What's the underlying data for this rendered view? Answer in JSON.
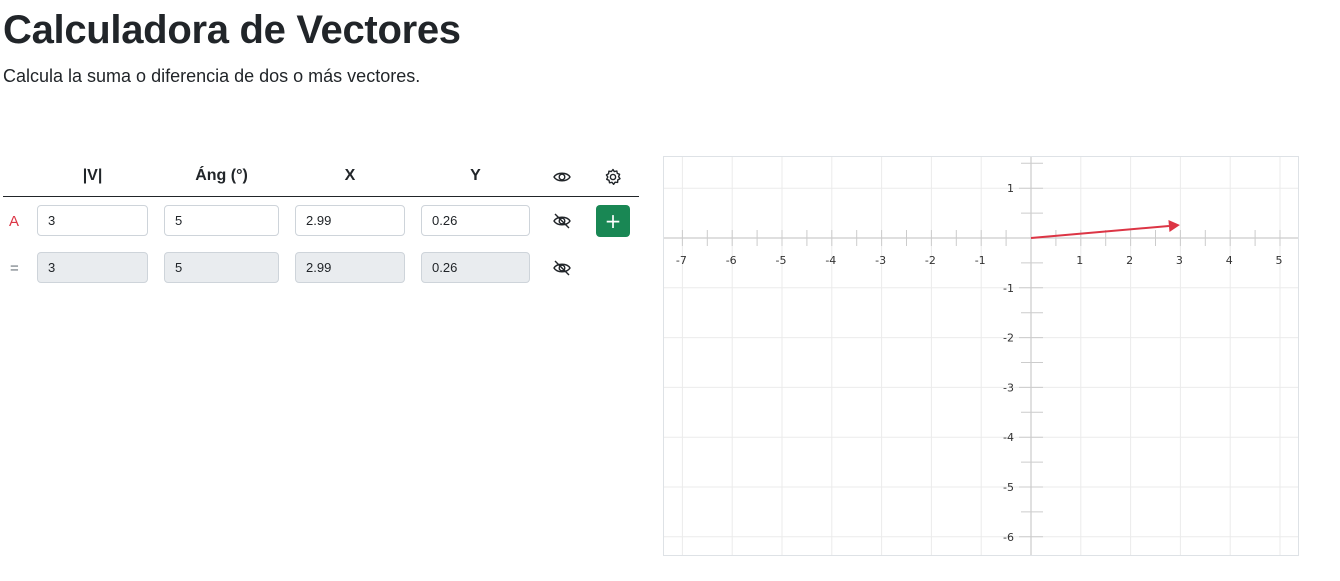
{
  "page": {
    "title": "Calculadora de Vectores",
    "subtitle": "Calcula la suma o diferencia de dos o más vectores."
  },
  "table": {
    "headers": {
      "magnitude": "|V|",
      "angle": "Áng (°)",
      "x": "X",
      "y": "Y"
    },
    "header_icons": {
      "visibility": "eye-icon",
      "settings": "gear-icon"
    },
    "rows": [
      {
        "label": "A",
        "magnitude": "3",
        "angle": "5",
        "x": "2.99",
        "y": "0.26",
        "visibility_icon": "eye-off-icon",
        "action": "+"
      },
      {
        "label": "=",
        "magnitude": "3",
        "angle": "5",
        "x": "2.99",
        "y": "0.26",
        "visibility_icon": "eye-off-icon",
        "readonly": true
      }
    ]
  },
  "colors": {
    "vector_a": "#dc3545",
    "add_button": "#198754",
    "readonly_field": "#e9ecef",
    "grid": "#ebebeb",
    "axis": "#cccccc"
  },
  "graph": {
    "x_ticks": [
      -7,
      -6,
      -5,
      -4,
      -3,
      -2,
      -1,
      1,
      2,
      3,
      4,
      5
    ],
    "y_ticks": [
      1,
      -1,
      -2,
      -3,
      -4,
      -5,
      -6
    ],
    "x_range": [
      -7.3,
      5.3
    ],
    "y_range": [
      -6.3,
      1.6
    ],
    "vectors": [
      {
        "name": "A",
        "from": [
          0,
          0
        ],
        "to": [
          2.99,
          0.26
        ]
      }
    ]
  }
}
